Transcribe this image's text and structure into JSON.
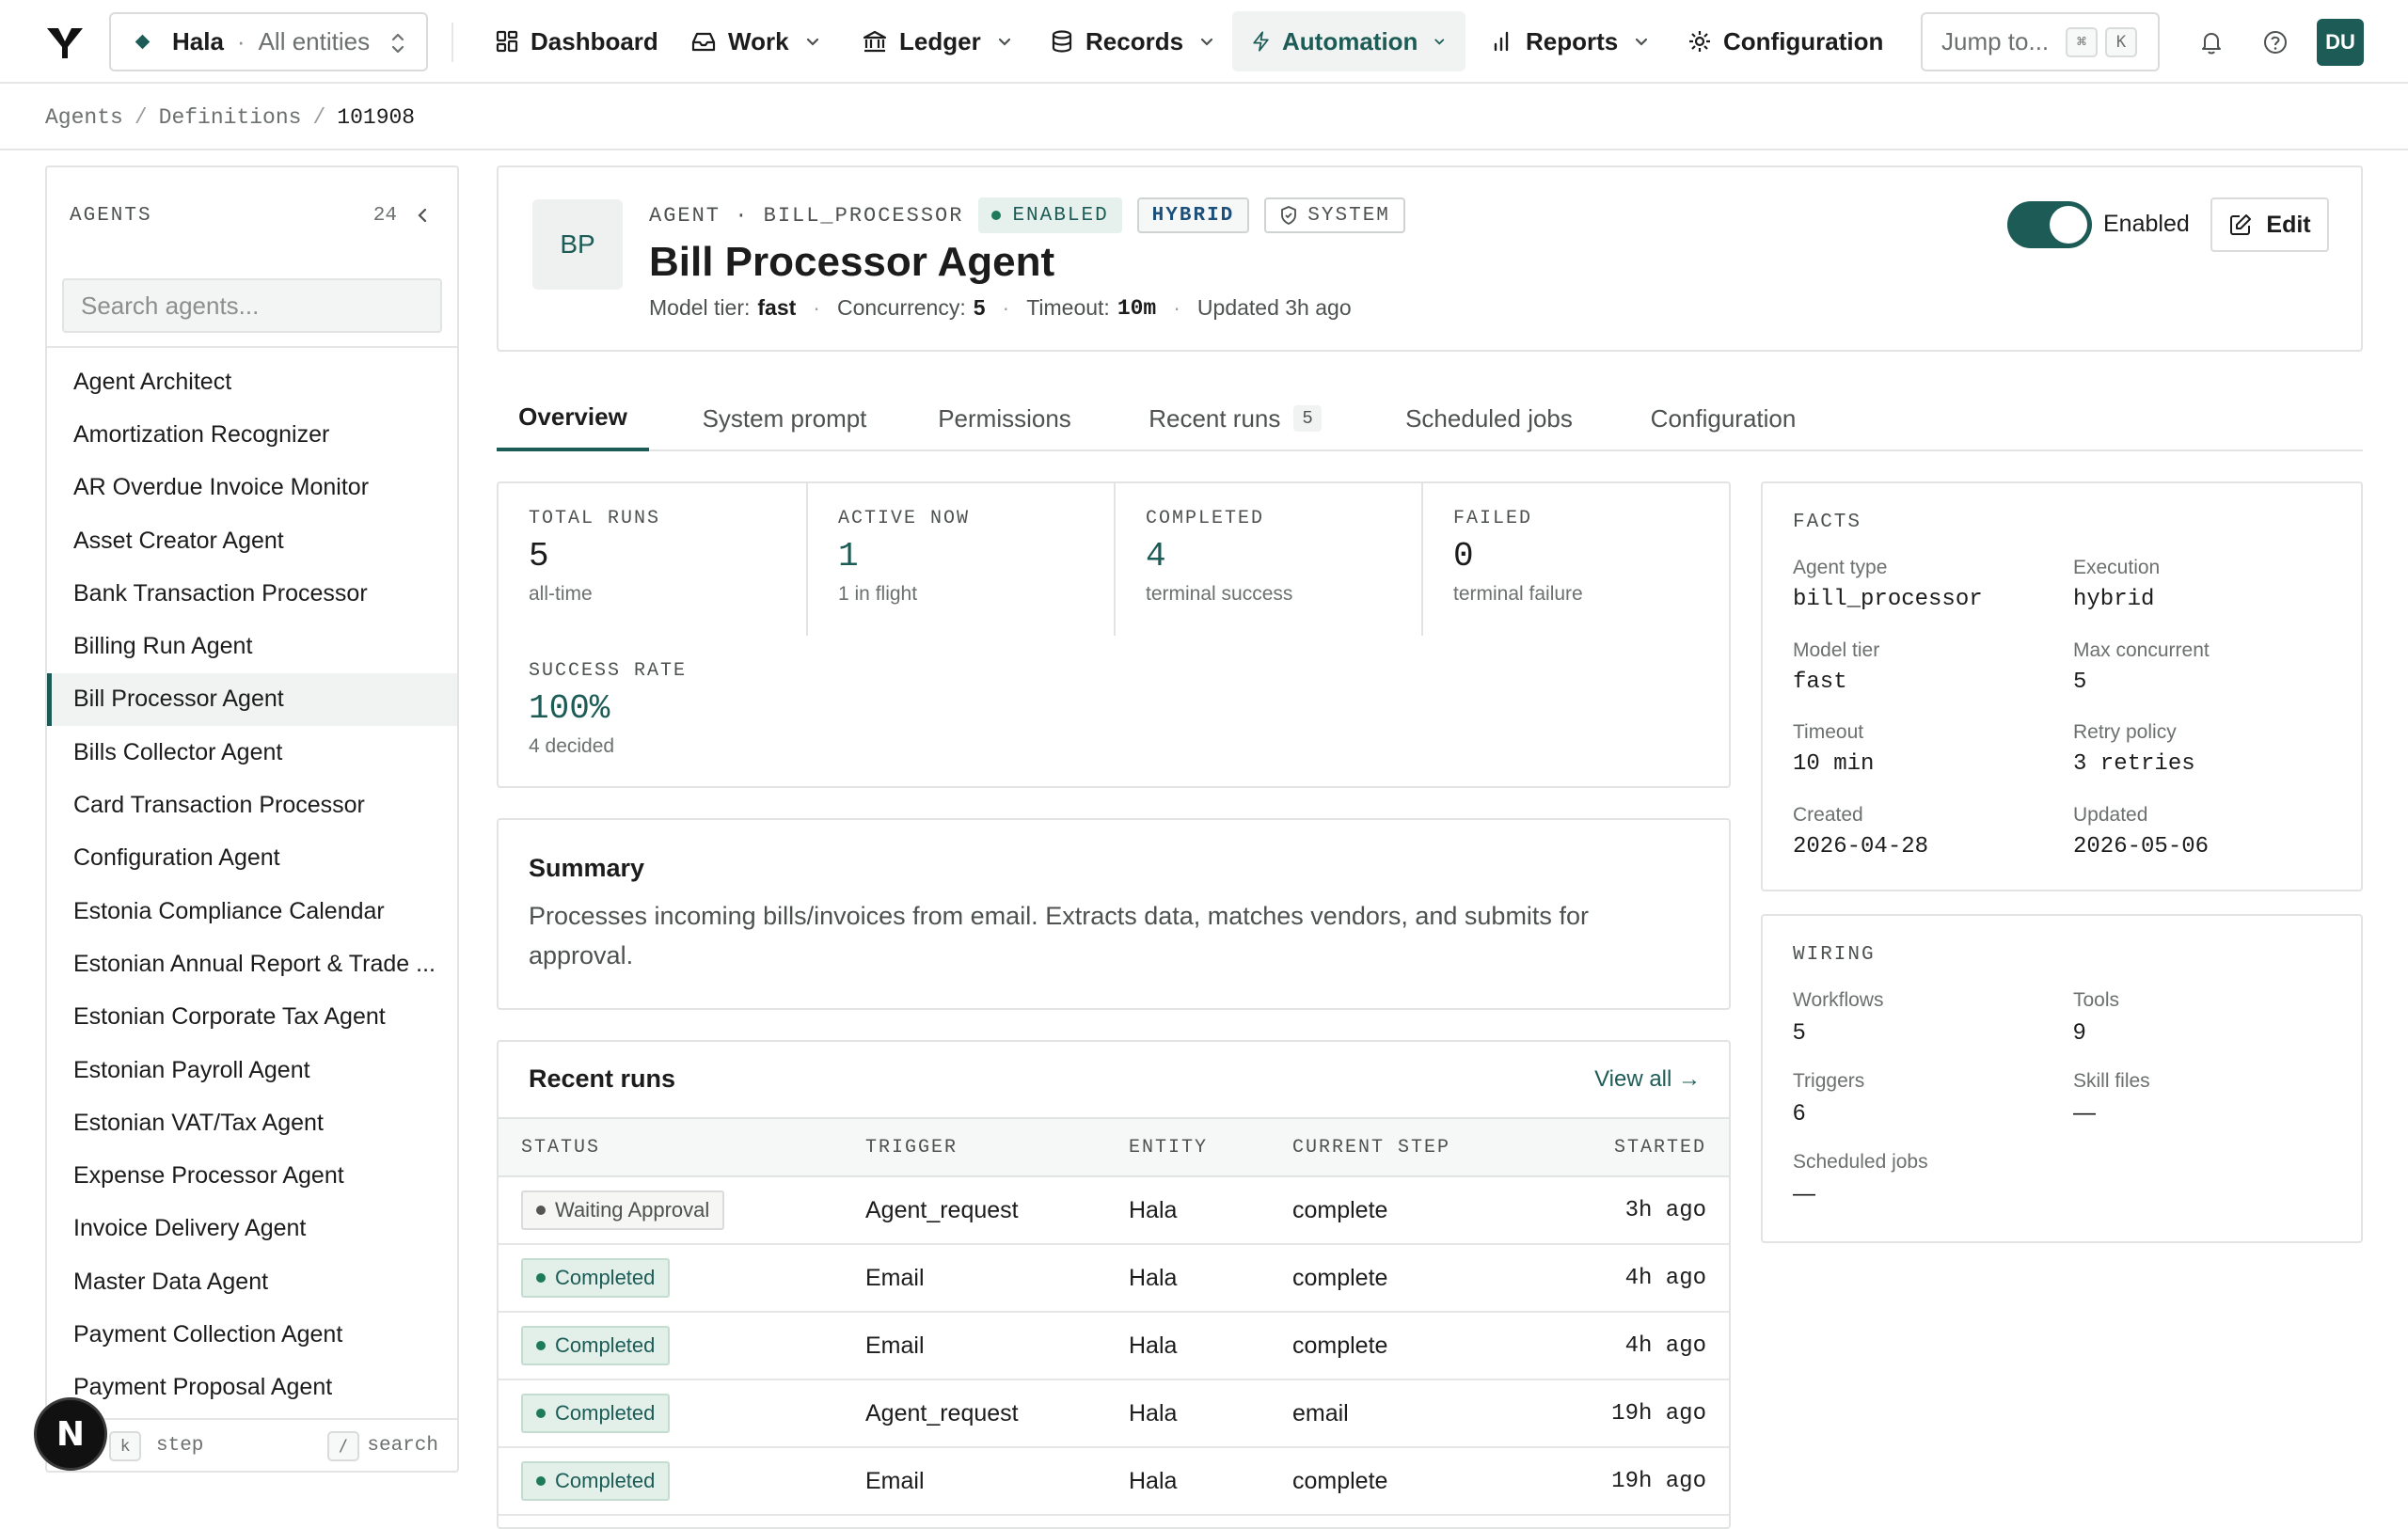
{
  "nav": {
    "entity_name": "Hala",
    "entity_scope": "All entities",
    "entity_separator": "·",
    "items": [
      {
        "label": "Dashboard",
        "icon": "grid-icon"
      },
      {
        "label": "Work",
        "icon": "inbox-icon"
      },
      {
        "label": "Ledger",
        "icon": "bank-icon"
      },
      {
        "label": "Records",
        "icon": "database-icon"
      },
      {
        "label": "Automation",
        "icon": "lightning-icon",
        "active": true
      },
      {
        "label": "Reports",
        "icon": "bar-chart-icon"
      },
      {
        "label": "Configuration",
        "icon": "gear-icon"
      }
    ],
    "jump_placeholder": "Jump to...",
    "jump_kbd_1": "⌘",
    "jump_kbd_2": "K",
    "avatar_initials": "DU"
  },
  "breadcrumb": {
    "items": [
      "Agents",
      "Definitions",
      "101908"
    ],
    "separator": "/"
  },
  "sidebar": {
    "title": "AGENTS",
    "count": "24",
    "search_placeholder": "Search agents...",
    "items": [
      "Agent Architect",
      "Amortization Recognizer",
      "AR Overdue Invoice Monitor",
      "Asset Creator Agent",
      "Bank Transaction Processor",
      "Billing Run Agent",
      "Bill Processor Agent",
      "Bills Collector Agent",
      "Card Transaction Processor",
      "Configuration Agent",
      "Estonia Compliance Calendar",
      "Estonian Annual Report & Trade ...",
      "Estonian Corporate Tax Agent",
      "Estonian Payroll Agent",
      "Estonian VAT/Tax Agent",
      "Expense Processor Agent",
      "Invoice Delivery Agent",
      "Master Data Agent",
      "Payment Collection Agent",
      "Payment Proposal Agent"
    ],
    "active_index": 6,
    "footer": {
      "key_1": "k",
      "label_1": "step",
      "key_2": "/",
      "label_2": "search"
    },
    "dev_badge": "N"
  },
  "agent": {
    "initials": "BP",
    "kind_label": "AGENT · BILL_PROCESSOR",
    "status_pill": "ENABLED",
    "mode_pill": "HYBRID",
    "system_pill": "SYSTEM",
    "title": "Bill Processor Agent",
    "model_tier_label": "Model tier:",
    "model_tier": "fast",
    "concurrency_label": "Concurrency:",
    "concurrency": "5",
    "timeout_label": "Timeout:",
    "timeout": "10m",
    "updated": "Updated 3h ago",
    "meta_sep": "·",
    "toggle_label": "Enabled",
    "toggle_on": true,
    "edit_label": "Edit"
  },
  "tabs": [
    {
      "label": "Overview",
      "active": true
    },
    {
      "label": "System prompt"
    },
    {
      "label": "Permissions"
    },
    {
      "label": "Recent runs",
      "count": "5"
    },
    {
      "label": "Scheduled jobs"
    },
    {
      "label": "Configuration"
    }
  ],
  "stats": [
    {
      "label": "TOTAL RUNS",
      "value": "5",
      "sub": "all-time"
    },
    {
      "label": "ACTIVE NOW",
      "value": "1",
      "sub": "1 in flight",
      "accent": true
    },
    {
      "label": "COMPLETED",
      "value": "4",
      "sub": "terminal success",
      "accent": true
    },
    {
      "label": "FAILED",
      "value": "0",
      "sub": "terminal failure"
    },
    {
      "label": "SUCCESS RATE",
      "value": "100%",
      "sub": "4 decided",
      "accent": true
    }
  ],
  "summary": {
    "title": "Summary",
    "text": "Processes incoming bills/invoices from email. Extracts data, matches vendors, and submits for approval."
  },
  "recent_runs": {
    "title": "Recent runs",
    "view_all": "View all →",
    "columns": [
      "STATUS",
      "TRIGGER",
      "ENTITY",
      "CURRENT STEP",
      "STARTED"
    ],
    "rows": [
      {
        "status": "Waiting Approval",
        "state": "waiting",
        "trigger": "Agent_request",
        "entity": "Hala",
        "step": "complete",
        "started": "3h ago"
      },
      {
        "status": "Completed",
        "state": "completed",
        "trigger": "Email",
        "entity": "Hala",
        "step": "complete",
        "started": "4h ago"
      },
      {
        "status": "Completed",
        "state": "completed",
        "trigger": "Email",
        "entity": "Hala",
        "step": "complete",
        "started": "4h ago"
      },
      {
        "status": "Completed",
        "state": "completed",
        "trigger": "Agent_request",
        "entity": "Hala",
        "step": "email",
        "started": "19h ago"
      },
      {
        "status": "Completed",
        "state": "completed",
        "trigger": "Email",
        "entity": "Hala",
        "step": "complete",
        "started": "19h ago"
      }
    ]
  },
  "facts": {
    "title": "FACTS",
    "items": [
      {
        "label": "Agent type",
        "value": "bill_processor"
      },
      {
        "label": "Execution",
        "value": "hybrid"
      },
      {
        "label": "Model tier",
        "value": "fast"
      },
      {
        "label": "Max concurrent",
        "value": "5"
      },
      {
        "label": "Timeout",
        "value": "10 min"
      },
      {
        "label": "Retry policy",
        "value": "3 retries"
      },
      {
        "label": "Created",
        "value": "2026-04-28"
      },
      {
        "label": "Updated",
        "value": "2026-05-06"
      }
    ]
  },
  "wiring": {
    "title": "WIRING",
    "items": [
      {
        "label": "Workflows",
        "value": "5"
      },
      {
        "label": "Tools",
        "value": "9"
      },
      {
        "label": "Triggers",
        "value": "6"
      },
      {
        "label": "Skill files",
        "value": "—"
      },
      {
        "label": "Scheduled jobs",
        "value": "—"
      }
    ]
  },
  "colors": {
    "accent": "#1d5c56",
    "success": "#1f7a5c",
    "border": "#e2e4e3"
  }
}
